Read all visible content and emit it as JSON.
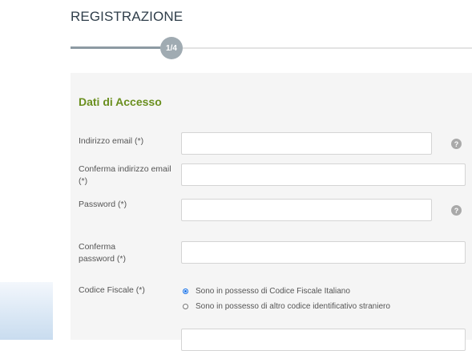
{
  "page": {
    "title": "REGISTRAZIONE"
  },
  "progress": {
    "step_label": "1/4",
    "current_step": 1,
    "total_steps": 4
  },
  "section": {
    "title": "Dati di Accesso"
  },
  "fields": {
    "email": {
      "label": "Indirizzo email (*)",
      "value": "",
      "help_icon": "question-icon"
    },
    "email_confirm": {
      "label": "Conferma indirizzo email (*)",
      "value": ""
    },
    "password": {
      "label": "Password (*)",
      "value": "",
      "help_icon": "question-icon"
    },
    "password_confirm": {
      "label": "Conferma password (*)",
      "value": ""
    },
    "codice_fiscale": {
      "label": "Codice Fiscale (*)",
      "options": [
        {
          "label": "Sono in possesso di Codice Fiscale Italiano",
          "selected": true
        },
        {
          "label": "Sono in possesso di altro codice identificativo straniero",
          "selected": false
        }
      ],
      "value": ""
    }
  },
  "colors": {
    "section_title": "#6a8f1f",
    "panel_bg": "#f5f5f5",
    "radio_selected": "#1a73e8",
    "progress_badge": "#a0abb2"
  }
}
